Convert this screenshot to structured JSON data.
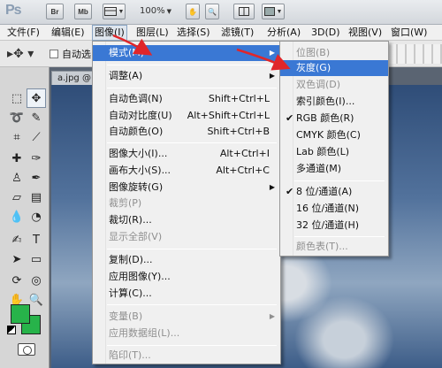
{
  "appbar": {
    "logo": "Ps",
    "btn_br": "Br",
    "btn_mb": "Mb",
    "zoom": "100%"
  },
  "menubar": {
    "items": [
      "文件(F)",
      "编辑(E)",
      "图像(I)",
      "图层(L)",
      "选择(S)",
      "滤镜(T)",
      "分析(A)",
      "3D(D)",
      "视图(V)",
      "窗口(W)"
    ]
  },
  "optbar": {
    "auto_select": "自动选"
  },
  "doc": {
    "tab": "a.jpg @"
  },
  "image_menu": {
    "items": [
      {
        "label": "模式(M)",
        "shortcut": "",
        "submenu": true,
        "highlighted": true
      },
      {
        "label": "调整(A)",
        "shortcut": "",
        "submenu": true
      },
      {
        "label": "自动色调(N)",
        "shortcut": "Shift+Ctrl+L"
      },
      {
        "label": "自动对比度(U)",
        "shortcut": "Alt+Shift+Ctrl+L"
      },
      {
        "label": "自动颜色(O)",
        "shortcut": "Shift+Ctrl+B"
      },
      {
        "label": "图像大小(I)...",
        "shortcut": "Alt+Ctrl+I"
      },
      {
        "label": "画布大小(S)...",
        "shortcut": "Alt+Ctrl+C"
      },
      {
        "label": "图像旋转(G)",
        "shortcut": "",
        "submenu": true
      },
      {
        "label": "裁剪(P)",
        "shortcut": "",
        "disabled": true
      },
      {
        "label": "裁切(R)...",
        "shortcut": ""
      },
      {
        "label": "显示全部(V)",
        "shortcut": "",
        "disabled": true
      },
      {
        "label": "复制(D)...",
        "shortcut": ""
      },
      {
        "label": "应用图像(Y)...",
        "shortcut": ""
      },
      {
        "label": "计算(C)...",
        "shortcut": ""
      },
      {
        "label": "变量(B)",
        "shortcut": "",
        "submenu": true,
        "disabled": true
      },
      {
        "label": "应用数据组(L)...",
        "shortcut": "",
        "disabled": true
      },
      {
        "label": "陷印(T)...",
        "shortcut": "",
        "disabled": true
      }
    ]
  },
  "mode_menu": {
    "items": [
      {
        "label": "位图(B)",
        "disabled": true
      },
      {
        "label": "灰度(G)",
        "highlighted": true
      },
      {
        "label": "双色调(D)",
        "disabled": true
      },
      {
        "label": "索引颜色(I)..."
      },
      {
        "label": "RGB 颜色(R)",
        "checked": true
      },
      {
        "label": "CMYK 颜色(C)"
      },
      {
        "label": "Lab 颜色(L)"
      },
      {
        "label": "多通道(M)"
      },
      {
        "label": "8 位/通道(A)",
        "checked": true
      },
      {
        "label": "16 位/通道(N)"
      },
      {
        "label": "32 位/通道(H)"
      },
      {
        "label": "颜色表(T)...",
        "disabled": true
      }
    ]
  },
  "swatches": {
    "foreground": "#27b34a",
    "background": "#27b34a"
  },
  "colors": {
    "menu_highlight": "#3a78d4",
    "annotation": "#e0262a"
  }
}
